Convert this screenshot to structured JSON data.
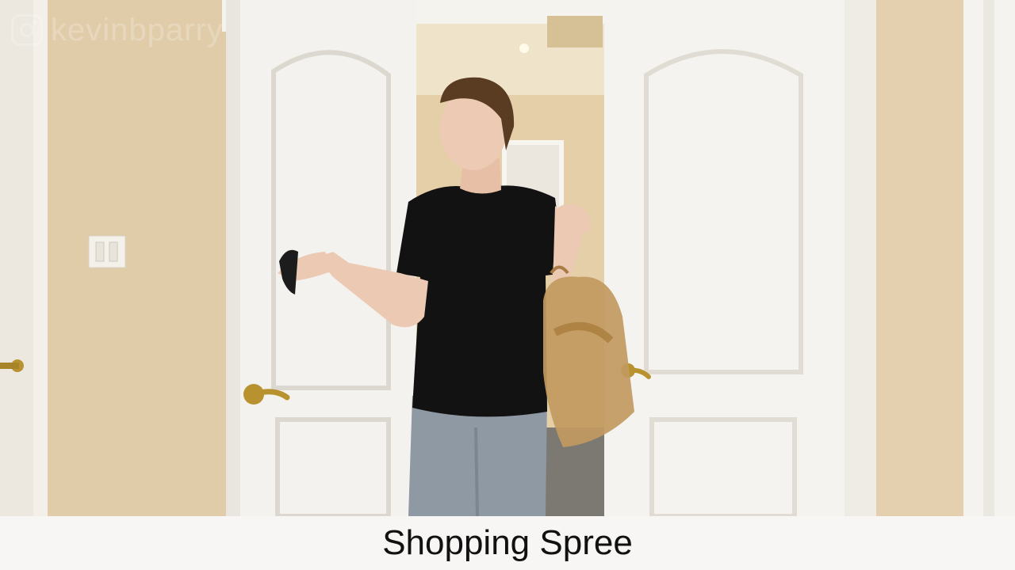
{
  "watermark": {
    "handle": "kevinbparry",
    "icon": "instagram-icon"
  },
  "caption": {
    "text": "Shopping Spree",
    "background": "#f7f6f4",
    "color": "#111111"
  },
  "scene": {
    "description_colors": {
      "wall": "#e8d4b4",
      "door": "#f4f2ee",
      "handle": "#b8922e",
      "shirt": "#111111",
      "jeans": "#8a94a0",
      "bag": "#b8905a"
    }
  }
}
